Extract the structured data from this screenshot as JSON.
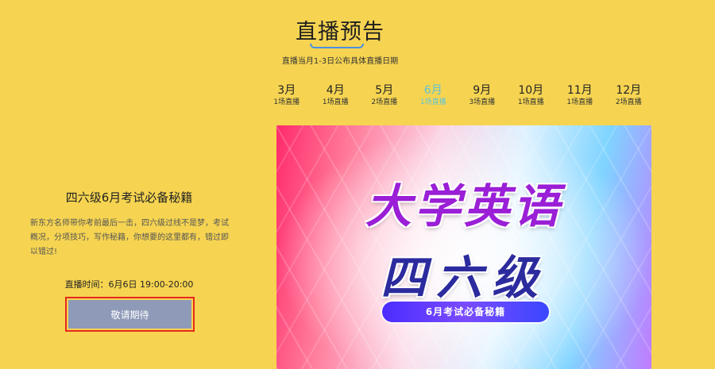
{
  "header": {
    "title": "直播预告",
    "subtitle": "直播当月1-3日公布具体直播日期"
  },
  "months": [
    {
      "month": "3月",
      "count": "1场直播",
      "active": false
    },
    {
      "month": "4月",
      "count": "1场直播",
      "active": false
    },
    {
      "month": "5月",
      "count": "2场直播",
      "active": false
    },
    {
      "month": "6月",
      "count": "1场直播",
      "active": true
    },
    {
      "month": "9月",
      "count": "3场直播",
      "active": false
    },
    {
      "month": "10月",
      "count": "1场直播",
      "active": false
    },
    {
      "month": "11月",
      "count": "1场直播",
      "active": false
    },
    {
      "month": "12月",
      "count": "2场直播",
      "active": false
    }
  ],
  "event": {
    "title": "四六级6月考试必备秘籍",
    "description": "新东方名师带你考前最后一击，四六级过线不是梦，考试概况，分项技巧，写作秘籍，你想要的这里都有，错过即以错过!",
    "time": "直播时间：6月6日   19:00-20:00",
    "button_label": "敬请期待"
  },
  "banner": {
    "line1": "大学英语",
    "line2": "四六级",
    "pill": "6月考试必备秘籍"
  },
  "colors": {
    "background": "#f6d451",
    "active_month": "#5fc3d6",
    "button": "#8e9ab8",
    "highlight_border": "#e8281e"
  }
}
